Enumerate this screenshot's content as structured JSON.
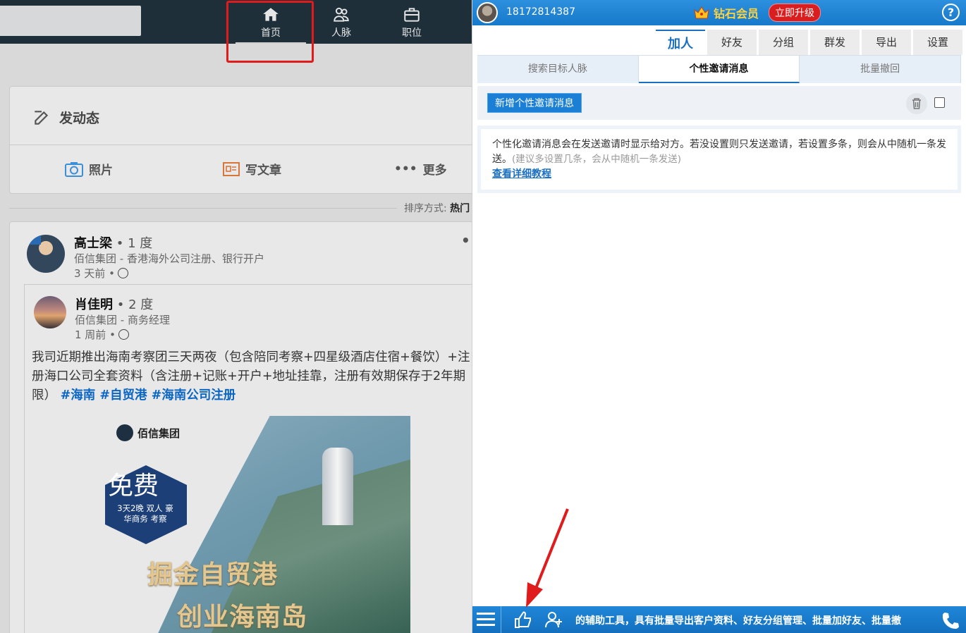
{
  "left": {
    "nav": {
      "home": "首页",
      "network": "人脉",
      "jobs": "职位"
    },
    "compose": {
      "title": "发动态",
      "photo": "照片",
      "article": "写文章",
      "more": "更多"
    },
    "sort": {
      "label": "排序方式:",
      "value": "热门"
    },
    "post": {
      "author": {
        "name": "高士梁",
        "degree": "• 1 度",
        "title": "佰信集团 - 香港海外公司注册、银行开户",
        "time": "3 天前 •"
      },
      "shared": {
        "name": "肖佳明",
        "degree": "• 2 度",
        "title": "佰信集团 - 商务经理",
        "time": "1 周前 •",
        "body": "我司近期推出海南考察团三天两夜（包含陪同考察+四星级酒店住宿+餐饮）+注册海口公司全套资料（含注册+记账+开户+地址挂靠，注册有效期保存于2年期限）",
        "tags": "#海南 #自贸港 #海南公司注册"
      },
      "image": {
        "logo": "佰信集团",
        "badge_big": "免费",
        "badge_small": "3天2晚 双人 豪华商务 考察",
        "slogan_1": "掘金自贸港",
        "slogan_2": "创业海南岛"
      }
    }
  },
  "panel": {
    "user_phone": "18172814387",
    "vip_label": "钻石会员",
    "upgrade_label": "立即升级",
    "help": "?",
    "main_tabs": [
      "加人",
      "好友",
      "分组",
      "群发",
      "导出",
      "设置"
    ],
    "sub_tabs": [
      "搜索目标人脉",
      "个性邀请消息",
      "批量撤回"
    ],
    "add_message_label": "新增个性邀请消息",
    "info": {
      "text": "个性化邀请消息会在发送邀请时显示给对方。若没设置则只发送邀请，若设置多条，则会从中随机一条发送。",
      "hint": "(建议多设置几条，会从中随机一条发送)",
      "link": "查看详细教程"
    },
    "bottom_marquee": "的辅助工具，具有批量导出客户资料、好友分组管理、批量加好友、批量撤"
  },
  "colors": {
    "panel_blue": "#1a7fd5",
    "annotation_red": "#e01b1b",
    "vip_gold": "#ffd33d"
  }
}
